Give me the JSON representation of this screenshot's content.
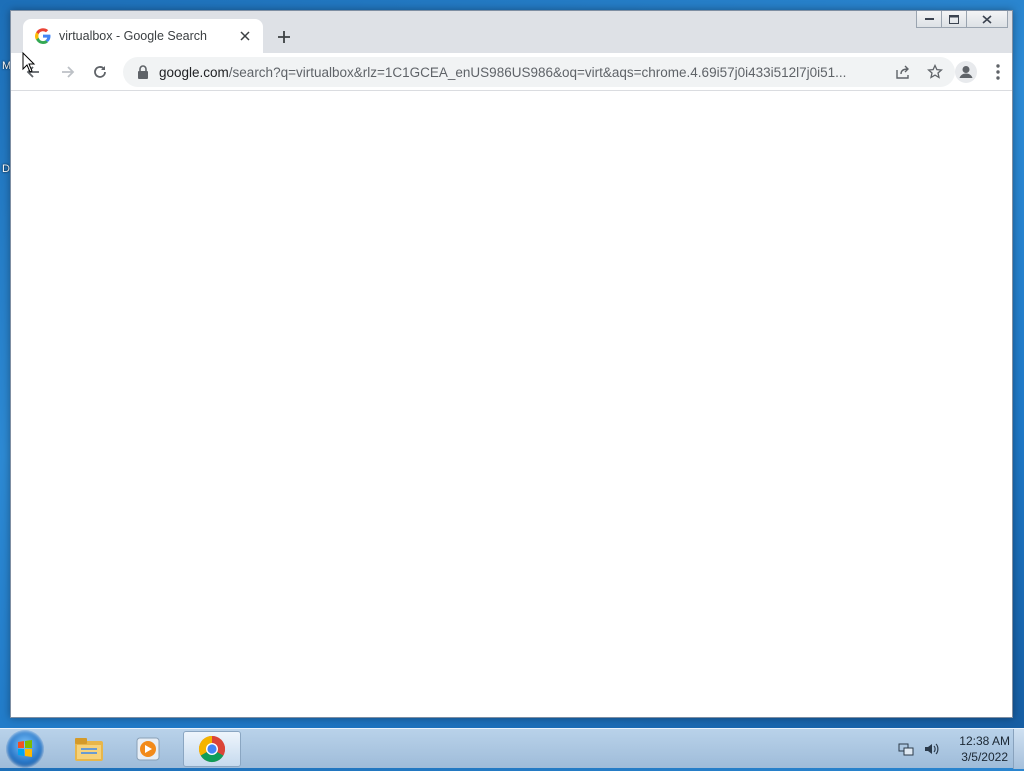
{
  "desktop": {
    "labels": [
      "M",
      "D"
    ]
  },
  "browser": {
    "tab": {
      "title": "virtualbox - Google Search",
      "favicon": "google-g-icon"
    },
    "omnibox": {
      "host": "google.com",
      "path": "/search?q=virtualbox&rlz=1C1GCEA_enUS986US986&oq=virt&aqs=chrome.4.69i57j0i433i512l7j0i51..."
    },
    "icons": {
      "back": "back-arrow-icon",
      "forward": "forward-arrow-icon",
      "reload": "reload-icon",
      "share": "share-icon",
      "bookmark": "star-icon",
      "profile": "profile-icon",
      "menu": "kebab-menu-icon"
    }
  },
  "taskbar": {
    "apps": [
      "explorer-folder-icon",
      "media-player-icon",
      "chrome-icon"
    ],
    "clock": {
      "time": "12:38 AM",
      "date": "3/5/2022"
    }
  },
  "colors": {
    "accent": "#1a73e8",
    "taskbar": "#aac4de",
    "desktop": "#2d8ad4"
  }
}
